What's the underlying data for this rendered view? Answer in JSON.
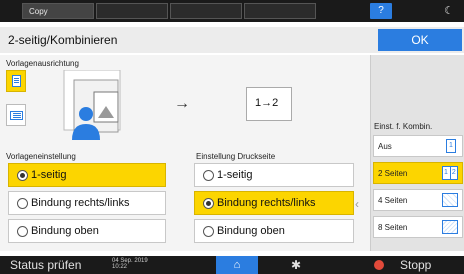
{
  "topbar": {
    "tabs": [
      "Copy",
      "",
      "",
      ""
    ],
    "help_label": "?",
    "moon_glyph": "☾"
  },
  "header": {
    "title": "2-seitig/Kombinieren",
    "ok_label": "OK"
  },
  "orientation": {
    "label": "Vorlagenausrichtung",
    "selected": "portrait",
    "duplex_text": "1→2"
  },
  "original_setting": {
    "label": "Vorlageneinstellung",
    "options": [
      "1-seitig",
      "Bindung rechts/links",
      "Bindung oben"
    ],
    "selected_index": 0
  },
  "print_setting": {
    "label": "Einstellung Druckseite",
    "options": [
      "1-seitig",
      "Bindung rechts/links",
      "Bindung oben"
    ],
    "selected_index": 1
  },
  "combine": {
    "label": "Einst. f. Kombin.",
    "items": [
      {
        "label": "Aus",
        "icon_text": "1"
      },
      {
        "label": "2 Seiten",
        "icon_text": "1 2"
      },
      {
        "label": "4 Seiten",
        "icon_text": ""
      },
      {
        "label": "8 Seiten",
        "icon_text": ""
      }
    ],
    "selected_index": 1
  },
  "bottombar": {
    "status_label": "Status prüfen",
    "date": "04 Sep. 2019",
    "time": "10:22",
    "stop_label": "Stopp"
  },
  "colors": {
    "accent": "#2b7de0",
    "selected": "#fcd500",
    "stop": "#e24a3a"
  }
}
